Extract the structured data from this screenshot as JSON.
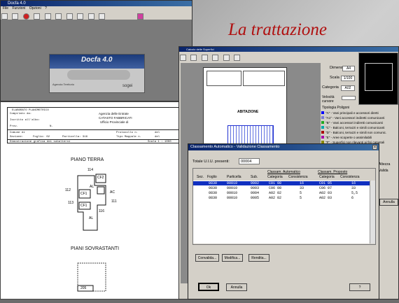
{
  "slide": {
    "title": "La trattazione"
  },
  "docfa": {
    "app_title": "Docfa 4.0",
    "menu": [
      "File",
      "Funzioni",
      "Opzioni",
      "?"
    ],
    "logo": "Docfa 4.0",
    "agency": "Agenzia Territorio",
    "brand": "sogei"
  },
  "plan": {
    "heading": "ELABORATO PLANIMETRICO",
    "sub1": "Compilato da:",
    "sub2": "Iscritto all'albo:",
    "sub3": "Prov.",
    "sub4": "N.",
    "office_1": "Agenzia delle Entrate",
    "office_2": "CATASTO FABBRICATI",
    "office_3": "Ufficio Provinciale di",
    "comune": "Comune di",
    "sezione": "Sezione:",
    "foglio": "Foglio: 02",
    "particella": "Particella: 316",
    "prot": "Protocollo n.",
    "tipo": "Tipo Mappale n.",
    "del1": "del",
    "del2": "del",
    "dimostr": "Dimostrazione grafica dei subalterni",
    "scala": "Scala 1 : 1000",
    "piano_terra": "PIANO TERRA",
    "piani_sovr": "PIANI SOVRASTANTI",
    "labels": [
      "114",
      "CF2",
      "AL",
      "CF1",
      "AC",
      "CF1",
      "AL",
      "116",
      "112",
      "113",
      "111",
      "205"
    ]
  },
  "sup_window": {
    "title": "Calcolo delle Superfici",
    "abitazione": "ABITAZIONE",
    "dimensioni_label": "Dimensioni",
    "dimensioni": "A4",
    "scala_label": "Scala",
    "scala": "1/100",
    "categoria_label": "Categoria",
    "categoria": "A02",
    "velocita_label": "Velocità cursore",
    "tipologia": "Tipologia Poligoni",
    "poligoni": [
      {
        "tag": "A",
        "text": "\"A\" - Vani principali e accessori diretti",
        "color": "#0000ff"
      },
      {
        "tag": "A1",
        "text": "\"A1\" - Vani accessori indiretti comunicanti",
        "color": "#7b7bd6"
      },
      {
        "tag": "B",
        "text": "\"B\" - Vani accessori indiretti comunicanti",
        "color": "#22aa22"
      },
      {
        "tag": "C",
        "text": "\"C\" - Balconi, terrazzi e simili comunicanti",
        "color": "#00aaaa"
      },
      {
        "tag": "D",
        "text": "\"D\" - Balconi, terrazzi e simili non comunic.",
        "color": "#aa0000"
      },
      {
        "tag": "E",
        "text": "\"E\" - Aree scoperte o assimilabili",
        "color": "#aa00aa"
      },
      {
        "tag": "F",
        "text": "\"F\" - Superfici non rilevanti ai fini catastali",
        "color": "#888800"
      }
    ],
    "altezza": "Altezza",
    "valida": "Valida",
    "annulla": "Annulla"
  },
  "dialog": {
    "title": "Classamento Automatico - Validazione Classamento",
    "totale_label": "Totale U.I.U. presenti:",
    "totale_value": "00004",
    "group_auto": "Classam. Automatico",
    "group_prop": "Classam. Proposto",
    "columns": [
      "Sez.",
      "Foglio",
      "Particella",
      "Sub.",
      "Categoria",
      "Consistenza",
      "Categoria",
      "Consistenza"
    ],
    "rows": [
      [
        "",
        "0830",
        "00010",
        "0002",
        "C01 08",
        "16",
        "C01 05",
        "16"
      ],
      [
        "",
        "0830",
        "00010",
        "0003",
        "C06 08",
        "33",
        "C06 07",
        "33"
      ],
      [
        "",
        "0830",
        "00010",
        "0004",
        "A02 02",
        "5",
        "A02 03",
        "5,5"
      ],
      [
        "",
        "0830",
        "00010",
        "0005",
        "A02 02",
        "5",
        "A02 03",
        "6"
      ]
    ],
    "convalida": "Convalida...",
    "modifica": "Modifica...",
    "rendita": "Rendita...",
    "ok": "Ok",
    "annulla": "Annulla",
    "help": "?"
  }
}
